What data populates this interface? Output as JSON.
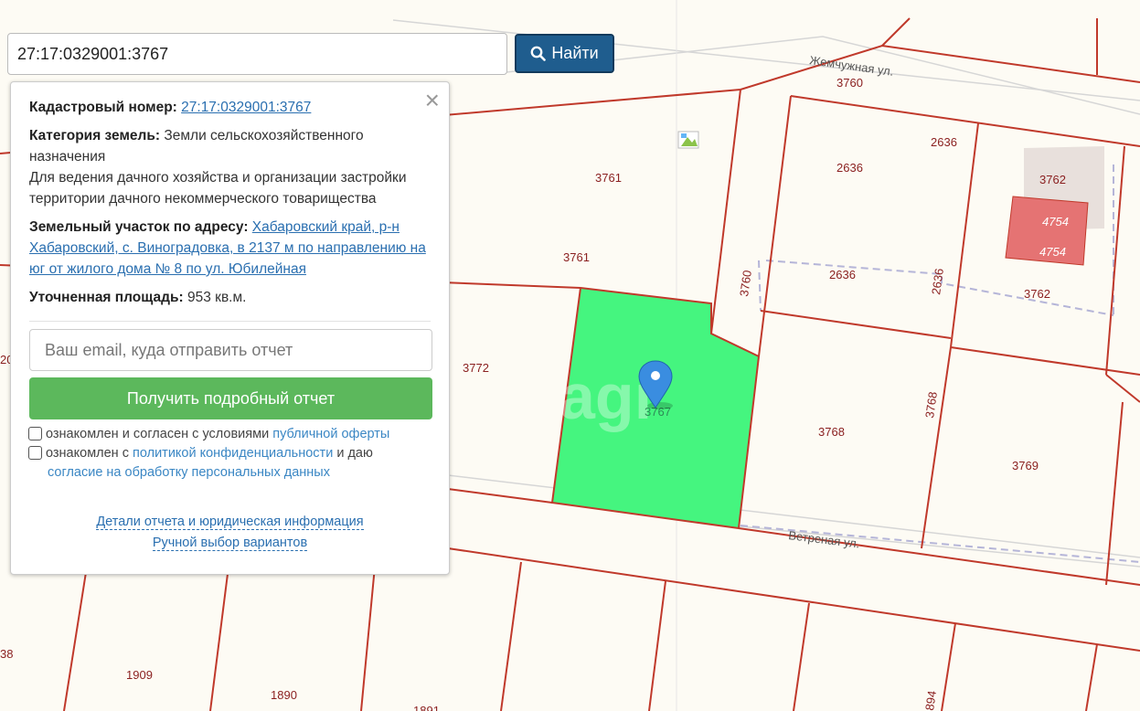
{
  "search": {
    "query": "27:17:0329001:3767",
    "button_label": "Найти"
  },
  "popup": {
    "cadastral_label": "Кадастровый номер:",
    "cadastral_value": "27:17:0329001:3767",
    "category_label": "Категория земель:",
    "category_value": "Земли сельскохозяйственного назначения",
    "usage": "Для ведения дачного хозяйства и организации застройки территории дачного некоммерческого товарищества",
    "address_label": "Земельный участок по адресу:",
    "address_value": "Хабаровский край, р-н Хабаровский, с. Виноградовка, в 2137 м по направлению на юг от жилого дома № 8 по ул. Юбилейная",
    "area_label": "Уточненная площадь:",
    "area_value": "953 кв.м.",
    "email_placeholder": "Ваш email, куда отправить отчет",
    "report_button": "Получить подробный отчет",
    "consent1_text": "ознакомлен и согласен с условиями",
    "consent1_link": "публичной оферты",
    "consent2_text": "ознакомлен с",
    "consent2_link": "политикой конфиденциальности",
    "consent2_tail": "и даю",
    "consent2_link2": "согласие на обработку персональных данных",
    "details_link": "Детали отчета и юридическая информация",
    "manual_link": "Ручной выбор вариантов"
  },
  "map": {
    "watermark": "agi",
    "colors": {
      "highlight": "#45f57f",
      "boundary": "#c0392b",
      "building": "#e57373"
    },
    "streets": [
      "Жемчужная ул.",
      "Ветреная ул."
    ],
    "parcels": [
      "3760",
      "2636",
      "2636",
      "3762",
      "3761",
      "3761",
      "3760",
      "2636",
      "2636",
      "3762",
      "4754",
      "4754",
      "3772",
      "3767",
      "3768",
      "3768",
      "3769",
      "1909",
      "1890",
      "38",
      "894",
      "20",
      "1891"
    ]
  }
}
